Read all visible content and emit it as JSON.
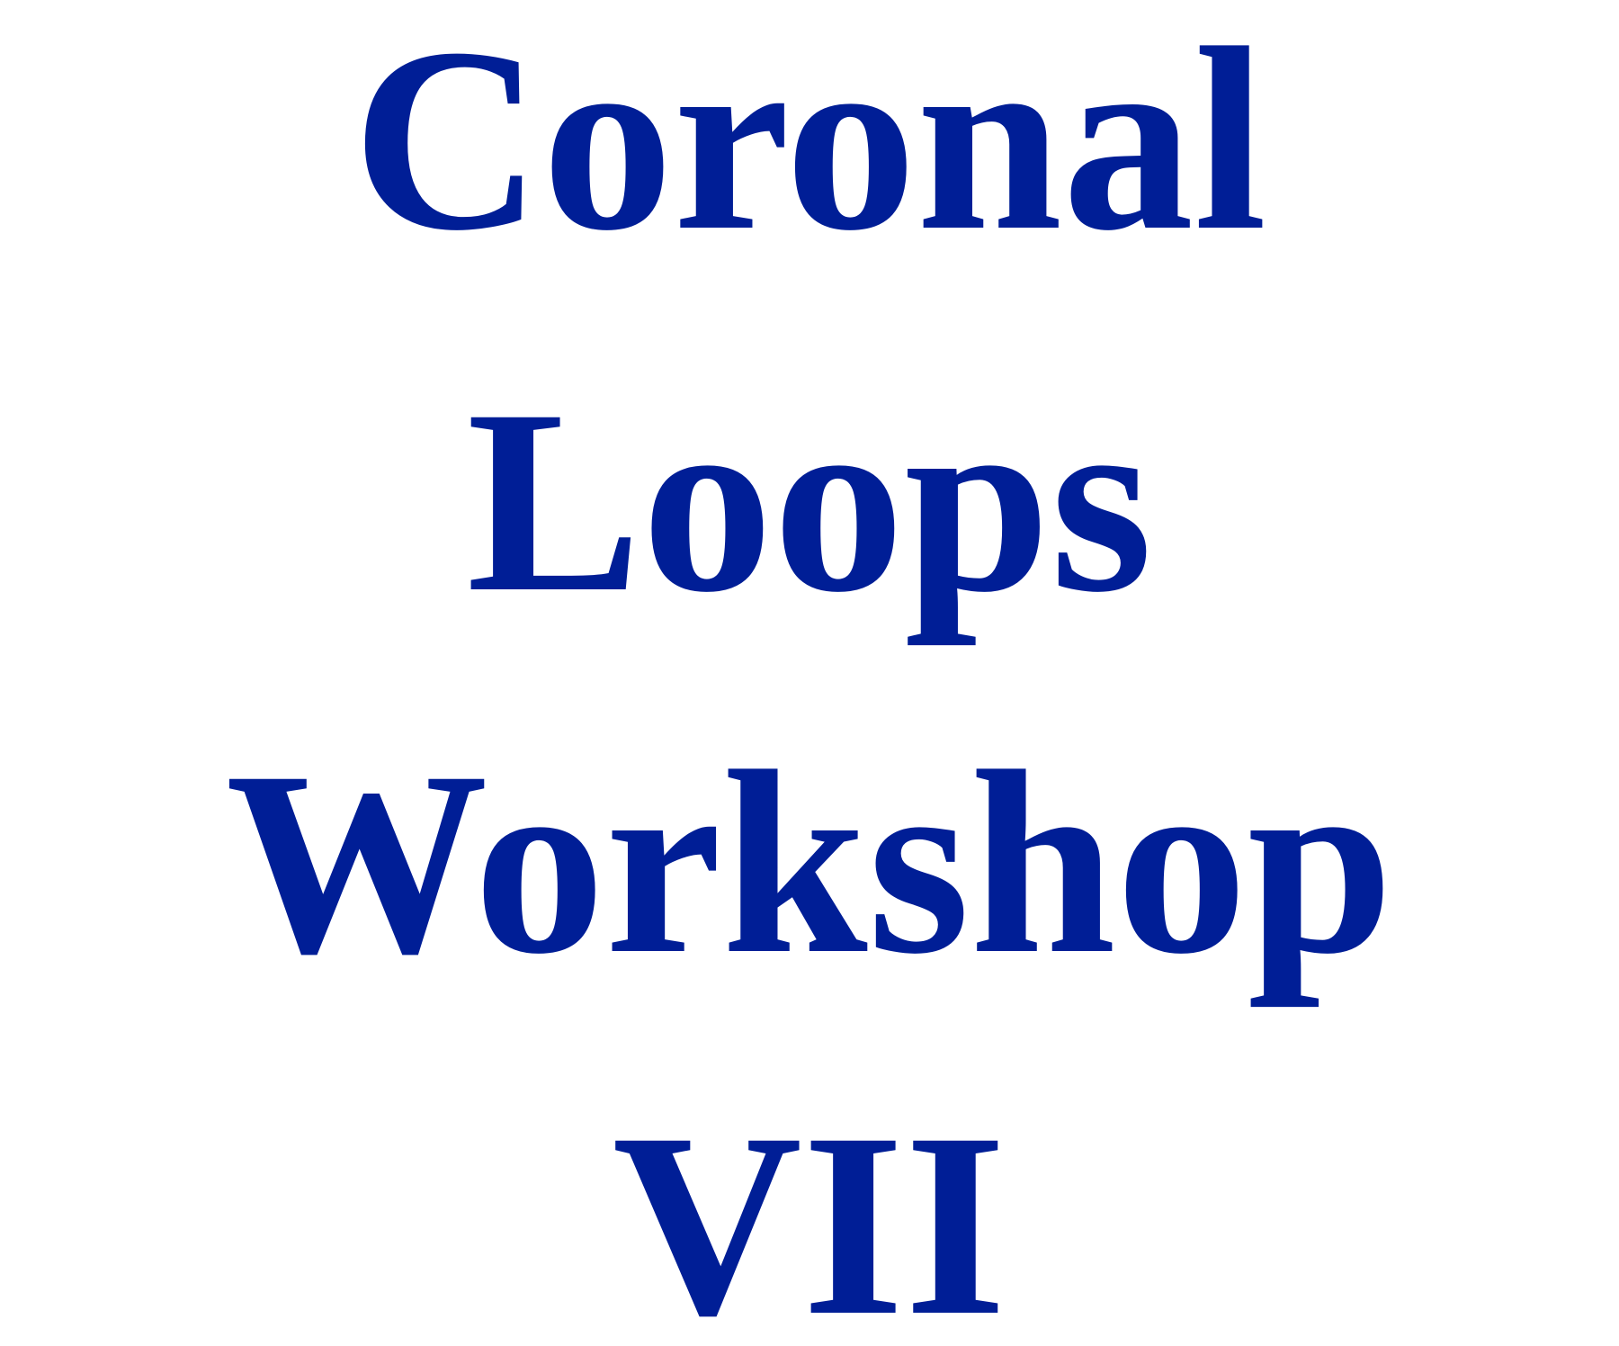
{
  "title": {
    "lines": [
      "Coronal",
      "Loops",
      "Workshop",
      "VII"
    ],
    "color": "#001e96"
  }
}
